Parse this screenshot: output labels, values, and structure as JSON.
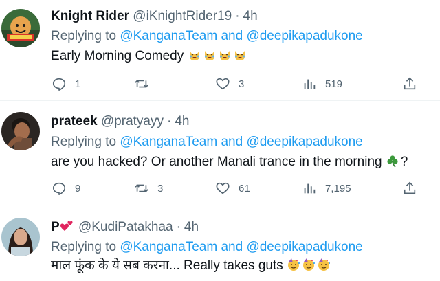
{
  "tweets": [
    {
      "name": "Knight Rider",
      "handle": "@iKnightRider19",
      "time": "4h",
      "replying_prefix": "Replying to",
      "mention1": "@KanganaTeam",
      "and": "and",
      "mention2": "@deepikapadukone",
      "text": "Early Morning Comedy",
      "emojis": [
        "laughing-crying-cat",
        "laughing-crying-cat",
        "laughing-crying-cat",
        "laughing-crying-cat"
      ],
      "replies": "1",
      "retweets": "",
      "likes": "3",
      "views": "519"
    },
    {
      "name": "prateek",
      "handle": "@pratyayy",
      "time": "4h",
      "replying_prefix": "Replying to",
      "mention1": "@KanganaTeam",
      "and": "and",
      "mention2": "@deepikapadukone",
      "text": "are you hacked? Or another Manali trance in the morning",
      "text_end": "?",
      "emojis": [
        "shamrock"
      ],
      "replies": "9",
      "retweets": "3",
      "likes": "61",
      "views": "7,195"
    },
    {
      "name": "P",
      "handle": "@KudiPatakhaa",
      "time": "4h",
      "replying_prefix": "Replying to",
      "mention1": "@KanganaTeam",
      "and": "and",
      "mention2": "@deepikapadukone",
      "text": "माल फूंक के ये सब करना... Really takes guts",
      "emojis": [
        "partying-face",
        "partying-face",
        "partying-face"
      ],
      "name_emojis": [
        "two-hearts"
      ]
    }
  ],
  "colors": {
    "link": "#1d9bf0",
    "secondary": "#536471",
    "primary": "#0f1419"
  }
}
